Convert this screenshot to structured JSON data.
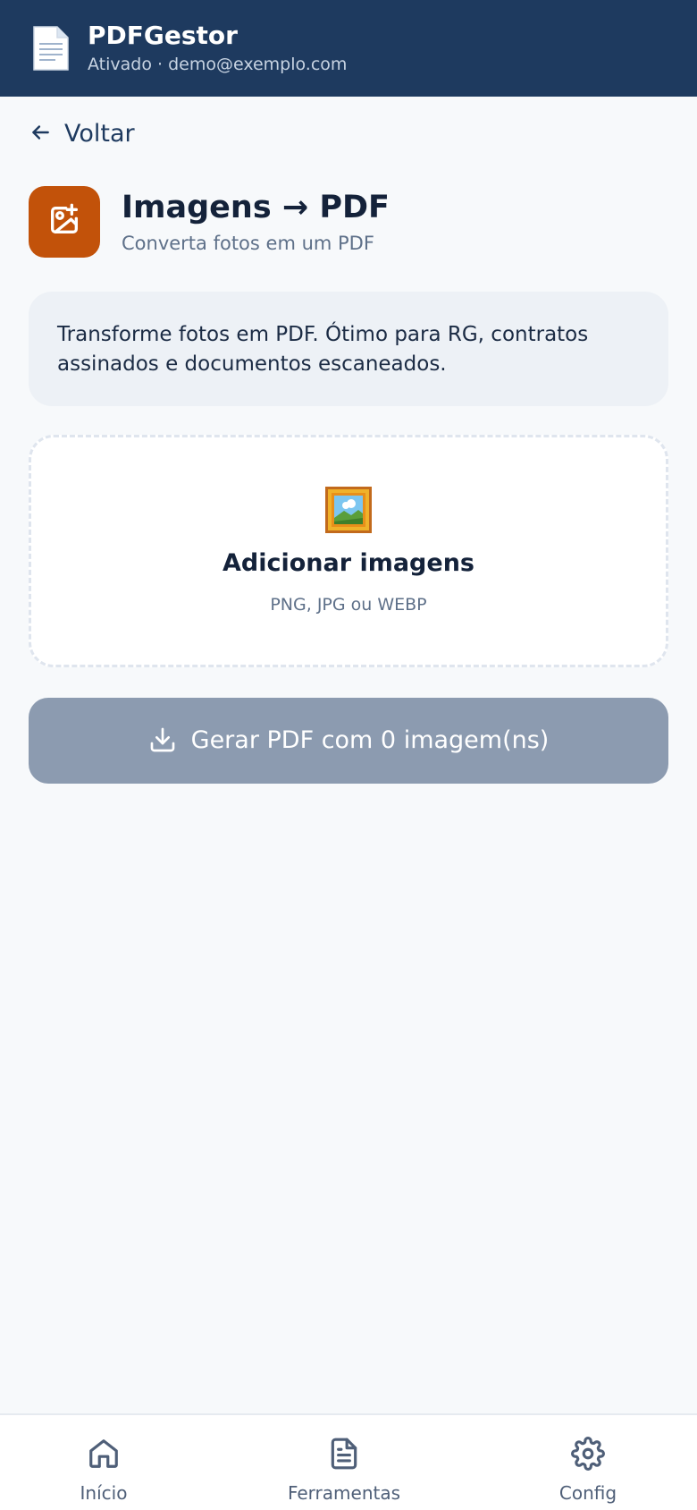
{
  "header": {
    "app_title": "PDFGestor",
    "status": "Ativado · demo@exemplo.com",
    "icon": "document-icon"
  },
  "back": {
    "label": "Voltar",
    "icon": "arrow-left-icon"
  },
  "tool": {
    "title": "Imagens → PDF",
    "subtitle": "Converta fotos em um PDF",
    "icon": "image-plus-icon",
    "accent": "#c2520a"
  },
  "info": {
    "text": "Transforme fotos em PDF. Ótimo para RG, contratos assinados e documentos escaneados."
  },
  "dropzone": {
    "icon": "framed-picture-icon",
    "title": "Adicionar imagens",
    "hint": "PNG, JPG ou WEBP"
  },
  "generate": {
    "label": "Gerar PDF com 0 imagem(ns)",
    "icon": "download-icon",
    "color": "#8c9bb0",
    "enabled": false
  },
  "bottom_nav": {
    "items": [
      {
        "label": "Início",
        "icon": "home-icon"
      },
      {
        "label": "Ferramentas",
        "icon": "file-text-icon"
      },
      {
        "label": "Config",
        "icon": "gear-icon"
      }
    ]
  },
  "colors": {
    "header_bg": "#1e3a5f",
    "page_bg": "#f7f9fb"
  }
}
